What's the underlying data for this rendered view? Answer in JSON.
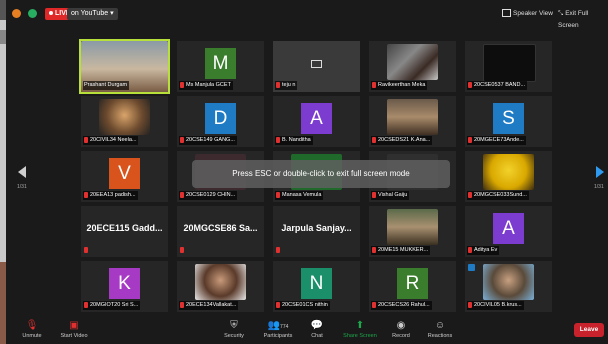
{
  "top": {
    "live": "LIVE",
    "on_youtube": "on YouTube",
    "speaker_view": "Speaker View",
    "exit_full": "Exit Full Screen"
  },
  "toast": "Press ESC or double-click to exit full screen mode",
  "pager": {
    "left": "1/31",
    "right": "1/31"
  },
  "colors": {
    "active_border": "#b8e03a",
    "live_red": "#e02828",
    "leave_red": "#c8232c",
    "share_green": "#1ea64a"
  },
  "tiles": [
    {
      "name": "Prashant Durgam"
    },
    {
      "name": "Ms Manjula GCET",
      "letter": "M",
      "color": "#3a7d2c"
    },
    {
      "name": "teju n"
    },
    {
      "name": "Ravikeerthan Meka"
    },
    {
      "name": "20CSE0537 BAND..."
    },
    {
      "name": "20CIVIL34 Neela..."
    },
    {
      "name": "20CSE149 GANG...",
      "letter": "D",
      "color": "#1f7bc4"
    },
    {
      "name": "B. Nanditha",
      "letter": "A",
      "color": "#7b3ccf"
    },
    {
      "name": "20CSEDS21 K.Ana..."
    },
    {
      "name": "20MGECE73Ande...",
      "letter": "S",
      "color": "#1f7bc4"
    },
    {
      "name": "20EEA13 padish...",
      "letter": "V",
      "color": "#d9541c"
    },
    {
      "name": "20CSE0129 CHIN..."
    },
    {
      "name": "Manasa Vemula"
    },
    {
      "name": "Vishal Gaiju"
    },
    {
      "name": "20MGCSE033Sund..."
    },
    {
      "name": "",
      "big": "20ECE115  Gadd..."
    },
    {
      "name": "",
      "big": "20MGCSE86  Sa..."
    },
    {
      "name": "",
      "big": "Jarpula  Sanjay..."
    },
    {
      "name": "20ME15 MUKKER..."
    },
    {
      "name": "Aditya Ev",
      "letter": "A",
      "color": "#7b3ccf"
    },
    {
      "name": "20MGIOT20 Sri S...",
      "letter": "K",
      "color": "#a73ac4"
    },
    {
      "name": "20ECE134Vallakat..."
    },
    {
      "name": "20CSE01CS nithin",
      "letter": "N",
      "color": "#1b8f6a"
    },
    {
      "name": "20CSECS26 Rahul...",
      "letter": "R",
      "color": "#3a7d2c"
    },
    {
      "name": "20CIVIL05 B.krus..."
    }
  ],
  "toolbar": {
    "unmute": "Unmute",
    "start_video": "Start Video",
    "security": "Security",
    "participants": "Participants",
    "participants_count": "774",
    "chat": "Chat",
    "share_screen": "Share Screen",
    "record": "Record",
    "reactions": "Reactions",
    "leave": "Leave"
  }
}
